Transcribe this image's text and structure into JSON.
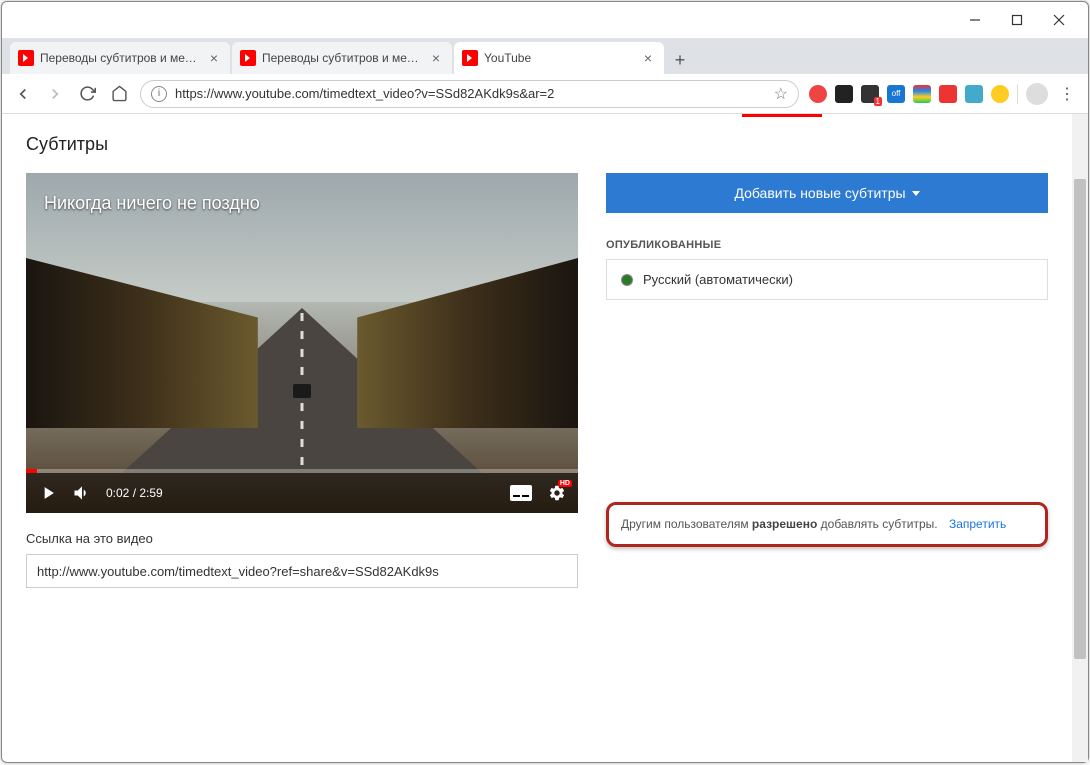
{
  "tabs": [
    {
      "title": "Переводы субтитров и метадан"
    },
    {
      "title": "Переводы субтитров и метадан"
    },
    {
      "title": "YouTube"
    }
  ],
  "url": "https://www.youtube.com/timedtext_video?v=SSd82AKdk9s&ar=2",
  "page": {
    "heading": "Субтитры",
    "video_title": "Никогда ничего не поздно",
    "time_current": "0:02",
    "time_total": "2:59",
    "hd": "HD",
    "link_label": "Ссылка на это видео",
    "link_value": "http://www.youtube.com/timedtext_video?ref=share&v=SSd82AKdk9s",
    "add_button": "Добавить новые субтитры",
    "published_label": "ОПУБЛИКОВАННЫЕ",
    "lang_item": "Русский (автоматически)",
    "notice_prefix": "Другим пользователям",
    "notice_bold": "разрешено",
    "notice_suffix": "добавлять субтитры.",
    "notice_link": "Запретить"
  }
}
